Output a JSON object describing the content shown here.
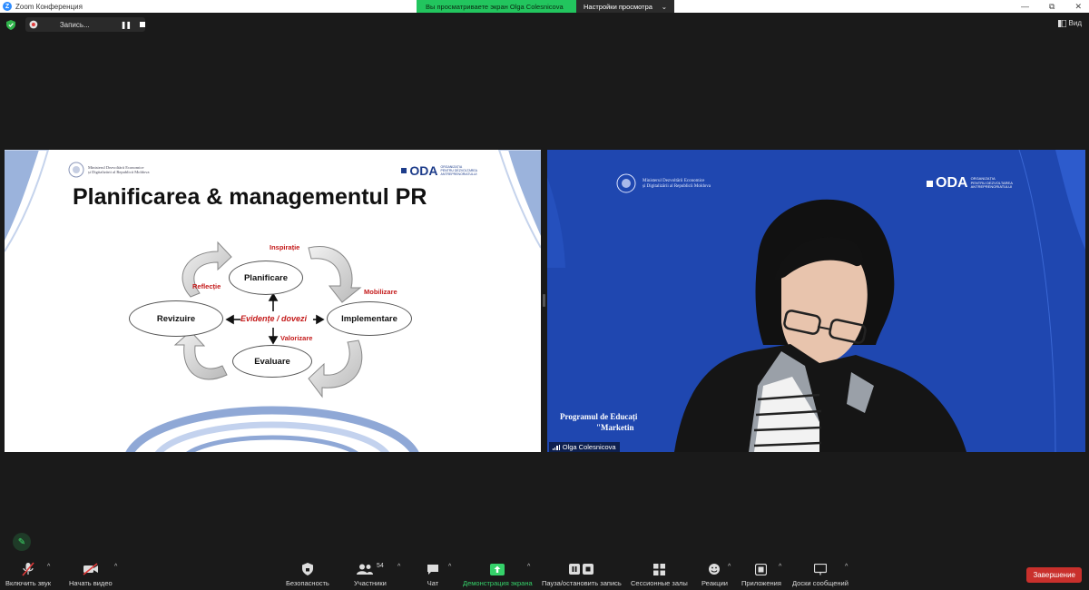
{
  "window": {
    "title": "Zoom Конференция"
  },
  "banner": {
    "sharing_text": "Вы просматриваете экран Olga Colesnicova",
    "view_options": "Настройки просмотра"
  },
  "recording": {
    "label": "Запись..."
  },
  "top": {
    "view_label": "Вид"
  },
  "slide": {
    "title": "Planificarea & managementul PR",
    "ministry_line1": "Ministerul Dezvoltării Economice",
    "ministry_line2": "și Digitalizării al Republicii Moldova",
    "oda": "ODA",
    "oda_sub1": "ORGANIZAȚIA",
    "oda_sub2": "PENTRU DEZVOLTAREA",
    "oda_sub3": "ANTREPRENORIATULUI",
    "nodes": {
      "planificare": "Planificare",
      "implementare": "Implementare",
      "evaluare": "Evaluare",
      "revizuire": "Revizuire"
    },
    "labels": {
      "inspiratie": "Inspirație",
      "mobilizare": "Mobilizare",
      "valorizare": "Valorizare",
      "reflectie": "Reflecție",
      "center": "Evidențe / dovezi"
    }
  },
  "camera": {
    "ministry_line1": "Ministerul Dezvoltării Economice",
    "ministry_line2": "și Digitalizării al Republicii Moldova",
    "oda": "ODA",
    "oda_sub1": "ORGANIZAȚIA",
    "oda_sub2": "PENTRU DEZVOLTAREA",
    "oda_sub3": "ANTREPRENORIATULUI",
    "program_line1": "Programul de Educați",
    "program_line2": "\"Marketin",
    "participant_name": "Olga Colesnicova"
  },
  "toolbar": {
    "unmute": "Включить звук",
    "start_video": "Начать видео",
    "security": "Безопасность",
    "participants": "Участники",
    "participants_count": "54",
    "chat": "Чат",
    "share_screen": "Демонстрация экрана",
    "pause_recording": "Пауза/остановить запись",
    "breakout_rooms": "Сессионные залы",
    "reactions": "Реакции",
    "apps": "Приложения",
    "whiteboards": "Доски сообщений",
    "end": "Завершение"
  },
  "colors": {
    "share_green": "#22c55e",
    "end_red": "#c9302c",
    "slide_accent": "#c41a1a",
    "camera_bg": "#1f47b0"
  },
  "icons": [
    "zoom-icon",
    "shield-icon",
    "cloud-record-icon",
    "pause-icon",
    "stop-icon",
    "view-icon",
    "mic-muted-icon",
    "video-off-icon",
    "security-shield-icon",
    "participants-icon",
    "chat-icon",
    "share-up-arrow-icon",
    "pause-stop-icon",
    "breakout-grid-icon",
    "reactions-icon",
    "apps-icon",
    "whiteboard-icon",
    "pencil-icon",
    "signal-icon"
  ]
}
